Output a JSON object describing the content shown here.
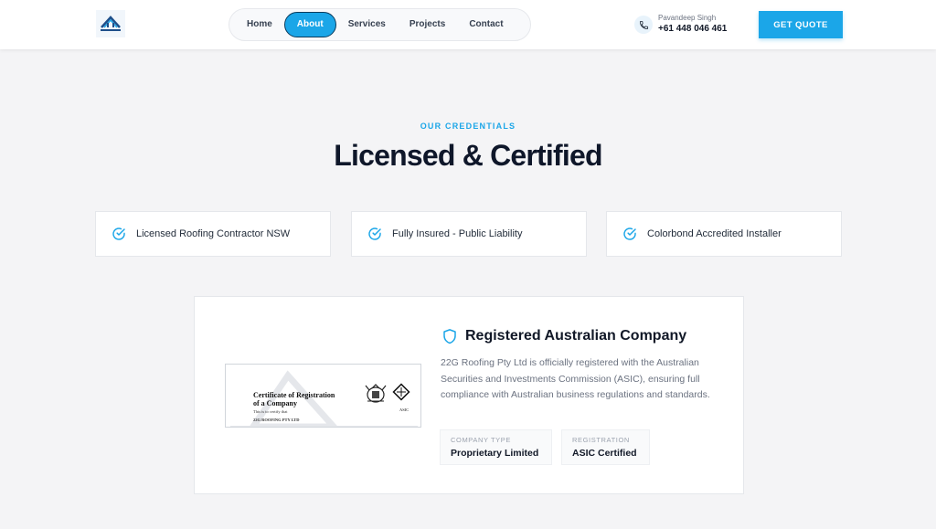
{
  "header": {
    "logo_icon": "roof-logo-icon",
    "nav": [
      {
        "label": "Home",
        "active": false
      },
      {
        "label": "About",
        "active": true
      },
      {
        "label": "Services",
        "active": false
      },
      {
        "label": "Projects",
        "active": false
      },
      {
        "label": "Contact",
        "active": false
      }
    ],
    "contact": {
      "icon": "phone-icon",
      "name": "Pavandeep Singh",
      "phone": "+61 448 046 461"
    },
    "cta_label": "GET QUOTE"
  },
  "section": {
    "eyebrow": "OUR CREDENTIALS",
    "title": "Licensed & Certified"
  },
  "credentials": [
    {
      "icon": "check-circle-icon",
      "label": "Licensed Roofing Contractor NSW"
    },
    {
      "icon": "check-circle-icon",
      "label": "Fully Insured - Public Liability"
    },
    {
      "icon": "check-circle-icon",
      "label": "Colorbond Accredited Installer"
    }
  ],
  "company": {
    "icon": "shield-icon",
    "title": "Registered Australian Company",
    "description": "22G Roofing Pty Ltd is officially registered with the Australian Securities and Investments Commission (ASIC), ensuring full compliance with Australian business regulations and standards.",
    "certificate": {
      "title_line1": "Certificate of Registration",
      "title_line2": "of a Company",
      "subtitle": "This is to certify that",
      "company_name": "22G ROOFING PTY LTD",
      "emblem": "asic-emblem",
      "asic_label": "ASIC"
    },
    "info": [
      {
        "label": "COMPANY TYPE",
        "value": "Proprietary Limited"
      },
      {
        "label": "REGISTRATION",
        "value": "ASIC Certified"
      }
    ]
  },
  "colors": {
    "accent": "#1ba6e8",
    "text_dark": "#0f172a",
    "background": "#f4f4f6"
  }
}
